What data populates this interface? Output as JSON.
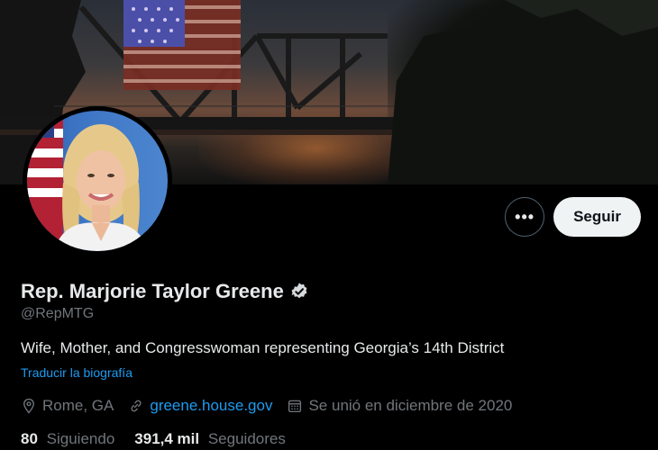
{
  "profile": {
    "name": "Rep. Marjorie Taylor Greene",
    "handle": "@RepMTG",
    "bio": "Wife, Mother, and Congresswoman representing Georgia’s 14th District",
    "translate_bio": "Traducir la biografía",
    "location": "Rome, GA",
    "website": "greene.house.gov",
    "joined": "Se unió en diciembre de 2020",
    "verified": true
  },
  "actions": {
    "more_label": "•••",
    "follow_label": "Seguir"
  },
  "stats": {
    "following_count": "80",
    "following_label": "Siguiendo",
    "followers_count": "391,4 mil",
    "followers_label": "Seguidores"
  },
  "colors": {
    "background": "#000000",
    "accent": "#1d9bf0",
    "secondary_text": "#71767b",
    "primary_text": "#e7e9ea",
    "follow_button_bg": "#eff3f4"
  },
  "icons": {
    "verified": "verified-badge-icon",
    "location": "location-pin-icon",
    "link": "link-icon",
    "calendar": "calendar-icon",
    "more": "more-dots-icon"
  }
}
